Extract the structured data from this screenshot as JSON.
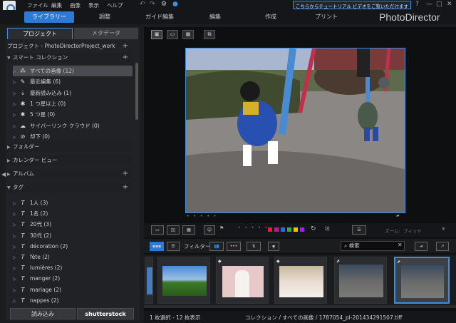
{
  "menu": {
    "items": [
      "ファイル",
      "編集",
      "画像",
      "表示",
      "ヘルプ"
    ],
    "notice": "こちらからチュートリアル ビデオをご覧いただけます"
  },
  "modules": {
    "tabs": [
      "ライブラリー",
      "調整",
      "ガイド編集",
      "編集",
      "作成",
      "プリント"
    ],
    "active": "ライブラリー",
    "brand": "PhotoDirector"
  },
  "left_panel": {
    "tabs": [
      "プロジェクト",
      "メタデータ"
    ],
    "project_label": "プロジェクト - PhotoDirectorProject_work",
    "smart_collection": "スマート コレクション",
    "smart_items": [
      {
        "label": "すべての画像 (12)",
        "icon": "all-images-icon"
      },
      {
        "label": "最近編集 (6)",
        "icon": "recent-edit-icon"
      },
      {
        "label": "最新読み込み (1)",
        "icon": "latest-import-icon"
      },
      {
        "label": "1 つ星以上 (0)",
        "icon": "one-star-icon"
      },
      {
        "label": "5 つ星 (0)",
        "icon": "five-star-icon"
      },
      {
        "label": "サイバーリンク クラウド (0)",
        "icon": "cloud-icon"
      },
      {
        "label": "却下 (0)",
        "icon": "reject-icon"
      }
    ],
    "folder": "フォルダー",
    "calendar": "カレンダー ビュー",
    "album": "アルバム",
    "tag": "タグ",
    "tag_items": [
      "1人 (3)",
      "1名 (2)",
      "20代 (3)",
      "30代 (2)",
      "décoration (2)",
      "fête (2)",
      "lumières (2)",
      "manger (2)",
      "mariage (2)",
      "nappes (2)"
    ],
    "import_button": "読み込み",
    "shutterstock_button": "shutterstock"
  },
  "toolbar": {
    "filter_label": "フィルター:",
    "search_placeholder": "検索",
    "zoom_label": "ズーム:",
    "fit_label": "フィット",
    "color_labels": [
      "#e0203a",
      "#c01a8a",
      "#2a6fd6",
      "#34a853",
      "#f2c200",
      "#a020f0"
    ]
  },
  "status": {
    "selection": "1 枚選択 - 12 枚表示",
    "path": "コレクション / すべての画像 / 1787054_pl-201434291507.tiff"
  }
}
